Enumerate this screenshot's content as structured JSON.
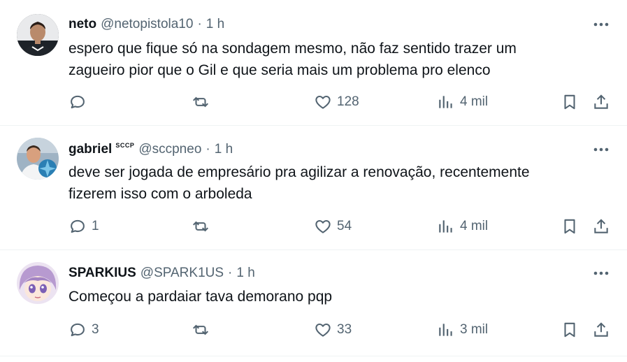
{
  "tweets": [
    {
      "name": "neto",
      "badge": "",
      "handle": "@netopistola10",
      "dot": "·",
      "time": "1 h",
      "lines": [
        "espero que fique só na sondagem mesmo, não faz sentido trazer um",
        "zagueiro pior que o Gil e que seria mais um problema pro elenco"
      ],
      "reply_count": "",
      "retweet_count": "",
      "like_count": "128",
      "view_count": "4 mil"
    },
    {
      "name": "gabriel",
      "badge": "SCCP",
      "handle": "@sccpneo",
      "dot": "·",
      "time": "1 h",
      "lines": [
        "deve ser jogada de empresário pra agilizar a renovação, recentemente",
        "fizerem isso com o arboleda"
      ],
      "reply_count": "1",
      "retweet_count": "",
      "like_count": "54",
      "view_count": "4 mil"
    },
    {
      "name": "SPARKIUS",
      "badge": "",
      "handle": "@SPARK1US",
      "dot": "·",
      "time": "1 h",
      "lines": [
        "Começou a pardaiar tava demorano pqp"
      ],
      "reply_count": "3",
      "retweet_count": "",
      "like_count": "33",
      "view_count": "3 mil"
    }
  ],
  "icons": {
    "more": "more-horizontal-icon",
    "reply": "reply-icon",
    "retweet": "retweet-icon",
    "like": "heart-icon",
    "views": "views-icon",
    "bookmark": "bookmark-icon",
    "share": "share-icon"
  },
  "colors": {
    "text": "#0f1419",
    "secondary": "#536471",
    "divider": "#eff3f4"
  }
}
